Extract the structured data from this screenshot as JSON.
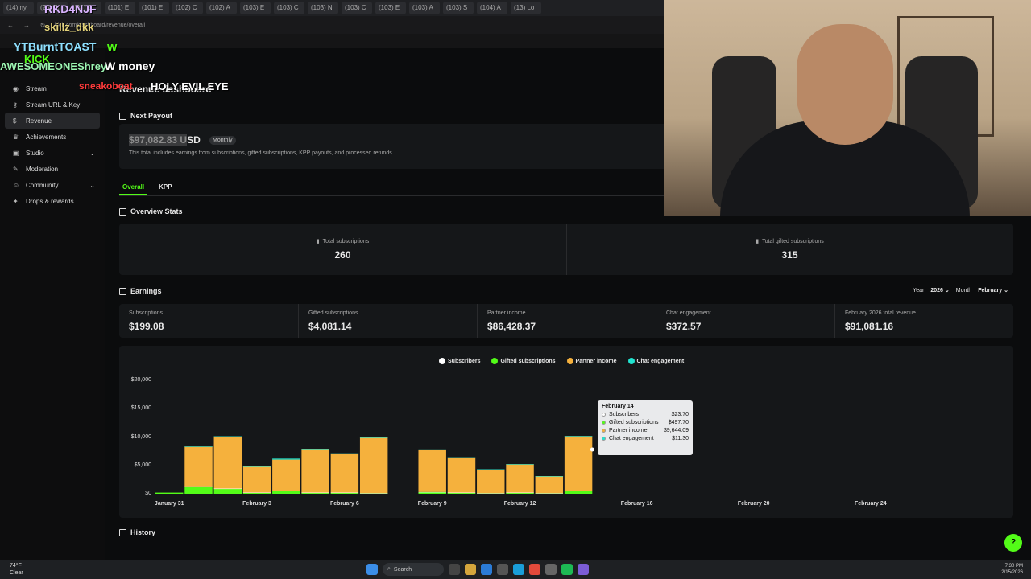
{
  "browser": {
    "tabs": [
      "(14) ny",
      "(28) Br",
      "(93) Cr",
      "(101) E",
      "(101) E",
      "(102) C",
      "(102) A",
      "(103) E",
      "(103) C",
      "(103) N",
      "(103) C",
      "(103) E",
      "(103) A",
      "(103) S",
      "(104) A",
      "(13) Lo"
    ],
    "url": "kick.com/dashboard/revenue/overall"
  },
  "stream_overlay": {
    "items": [
      {
        "text": "RKD4NJF",
        "color": "#d9b3ff"
      },
      {
        "text": "skillz_dkk",
        "color": "#e4d37a"
      },
      {
        "text": "YTBurntTOAST",
        "color": "#8ee0ff"
      },
      {
        "text": "W",
        "color": "#53fc18"
      },
      {
        "text": "KICK",
        "color": "#53fc18"
      },
      {
        "text": "AWESOMEONEShrey",
        "color": "#9cf5b2"
      },
      {
        "text": "W money",
        "color": "#ffffff"
      },
      {
        "text": "sneakoboat",
        "color": "#ff3b3b"
      },
      {
        "text": "HOLY EVIL EYE",
        "color": "#ffffff"
      }
    ]
  },
  "sidebar": {
    "items": [
      {
        "label": "Stream",
        "icon": "broadcast-icon"
      },
      {
        "label": "Stream URL & Key",
        "icon": "key-icon"
      },
      {
        "label": "Revenue",
        "icon": "dollar-icon",
        "active": true
      },
      {
        "label": "Achievements",
        "icon": "trophy-icon"
      },
      {
        "label": "Studio",
        "icon": "studio-icon",
        "expandable": true
      },
      {
        "label": "Moderation",
        "icon": "wrench-icon"
      },
      {
        "label": "Community",
        "icon": "community-icon",
        "expandable": true
      },
      {
        "label": "Drops & rewards",
        "icon": "gift-icon"
      }
    ]
  },
  "page": {
    "title": "Revenue dashboard",
    "next_payout_heading": "Next Payout",
    "payout_amount_prefix": "$97,082.83 U",
    "payout_amount_suffix": "SD",
    "payout_badge": "Monthly",
    "payout_note": "This total includes earnings from subscriptions, gifted subscriptions, KPP payouts, and processed refunds.",
    "tabs": [
      {
        "label": "Overall",
        "active": true
      },
      {
        "label": "KPP",
        "active": false
      }
    ],
    "overview_heading": "Overview Stats",
    "overview": [
      {
        "label": "Total subscriptions",
        "value": "260"
      },
      {
        "label": "Total gifted subscriptions",
        "value": "315"
      }
    ],
    "earnings_heading": "Earnings",
    "filters": {
      "year_label": "Year",
      "year_value": "2026",
      "month_label": "Month",
      "month_value": "February"
    },
    "earnings": [
      {
        "label": "Subscriptions",
        "value": "$199.08"
      },
      {
        "label": "Gifted subscriptions",
        "value": "$4,081.14"
      },
      {
        "label": "Partner income",
        "value": "$86,428.37"
      },
      {
        "label": "Chat engagement",
        "value": "$372.57"
      },
      {
        "label": "February 2026 total revenue",
        "value": "$91,081.16"
      }
    ],
    "history_heading": "History"
  },
  "chart_data": {
    "type": "bar",
    "stacked": true,
    "x_tick_labels": [
      "January 31",
      "February 3",
      "February 6",
      "February 9",
      "February 12",
      "February 16",
      "February 20",
      "February 24"
    ],
    "y_tick_labels": [
      "$20,000",
      "$15,000",
      "$10,000",
      "$5,000",
      "$0"
    ],
    "ylim": [
      0,
      20000
    ],
    "categories": [
      "Jan 31",
      "Feb 1",
      "Feb 2",
      "Feb 3",
      "Feb 4",
      "Feb 5",
      "Feb 6",
      "Feb 7",
      "Feb 8",
      "Feb 9",
      "Feb 10",
      "Feb 11",
      "Feb 12",
      "Feb 13",
      "Feb 14",
      "Feb 15",
      "Feb 16",
      "Feb 17",
      "Feb 18",
      "Feb 19",
      "Feb 20",
      "Feb 21",
      "Feb 22",
      "Feb 23",
      "Feb 24",
      "Feb 25",
      "Feb 26",
      "Feb 27",
      "Feb 28"
    ],
    "series": [
      {
        "name": "Subscribers",
        "color": "#ffffff",
        "values": [
          0,
          20,
          20,
          20,
          10,
          10,
          10,
          10,
          0,
          10,
          10,
          10,
          10,
          10,
          24,
          0,
          0,
          0,
          0,
          0,
          0,
          0,
          0,
          0,
          0,
          0,
          0,
          0,
          0
        ]
      },
      {
        "name": "Gifted subscriptions",
        "color": "#53fc18",
        "values": [
          200,
          1300,
          900,
          200,
          500,
          200,
          200,
          100,
          0,
          300,
          200,
          100,
          200,
          100,
          498,
          0,
          0,
          0,
          0,
          0,
          0,
          0,
          0,
          0,
          0,
          0,
          0,
          0,
          0
        ]
      },
      {
        "name": "Partner income",
        "color": "#f5b13d",
        "values": [
          0,
          7000,
          9200,
          4600,
          5500,
          7700,
          6900,
          9800,
          0,
          7500,
          6200,
          4200,
          5000,
          3000,
          9644,
          0,
          0,
          0,
          0,
          0,
          0,
          0,
          0,
          0,
          0,
          0,
          0,
          0,
          0
        ]
      },
      {
        "name": "Chat engagement",
        "color": "#21e4d0",
        "values": [
          0,
          10,
          10,
          10,
          180,
          20,
          10,
          10,
          0,
          10,
          10,
          10,
          10,
          10,
          11,
          0,
          0,
          0,
          0,
          0,
          0,
          0,
          0,
          0,
          0,
          0,
          0,
          0,
          0
        ]
      }
    ],
    "tooltip": {
      "date": "February 14",
      "rows": [
        {
          "label": "Subscribers",
          "value": "$23.70",
          "color": "#ffffff"
        },
        {
          "label": "Gifted subscriptions",
          "value": "$497.70",
          "color": "#53fc18"
        },
        {
          "label": "Partner income",
          "value": "$9,644.09",
          "color": "#f5b13d"
        },
        {
          "label": "Chat engagement",
          "value": "$11.30",
          "color": "#21e4d0"
        }
      ]
    }
  },
  "taskbar": {
    "weather_temp": "74°F",
    "weather_desc": "Clear",
    "search_placeholder": "Search",
    "time": "7:30 PM",
    "date": "2/15/2026"
  }
}
